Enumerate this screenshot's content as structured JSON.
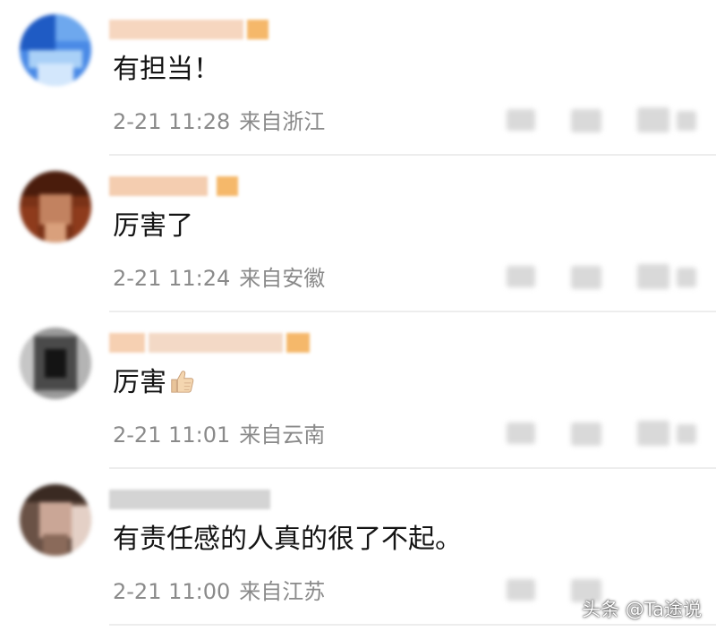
{
  "comments": [
    {
      "text": "有担当！",
      "time": "2-21 11:28",
      "location": "来自浙江",
      "avatar_colors": [
        "#2f6fd6",
        "#7fb3f0",
        "#5aa0ef",
        "#cfe3fb",
        "#3c7de0",
        "#9cc7f5"
      ],
      "name_color": "#f4c9a8"
    },
    {
      "text": "厉害了",
      "time": "2-21 11:24",
      "location": "来自安徽",
      "avatar_colors": [
        "#5a2a14",
        "#8b3a1f",
        "#c07a52",
        "#3e1a0c",
        "#a65430",
        "#d9a07c"
      ],
      "name_color": "#f2c6a2"
    },
    {
      "text": "厉害",
      "time": "2-21 11:01",
      "location": "来自云南",
      "avatar_colors": [
        "#1a1a1a",
        "#4d4d4d",
        "#7a7a7a",
        "#2b2b2b",
        "#a0a0a0",
        "#3a3a3a"
      ],
      "name_color": "#f4c6a0"
    },
    {
      "text": "有责任感的人真的很了不起。",
      "time": "2-21 11:00",
      "location": "来自江苏",
      "avatar_colors": [
        "#3a2a22",
        "#8a6a5a",
        "#c9a898",
        "#5a4034",
        "#e0c8bc",
        "#2a1d18"
      ],
      "name_color": "#d0d0d0"
    }
  ],
  "watermark": "头条 @Ta途说"
}
